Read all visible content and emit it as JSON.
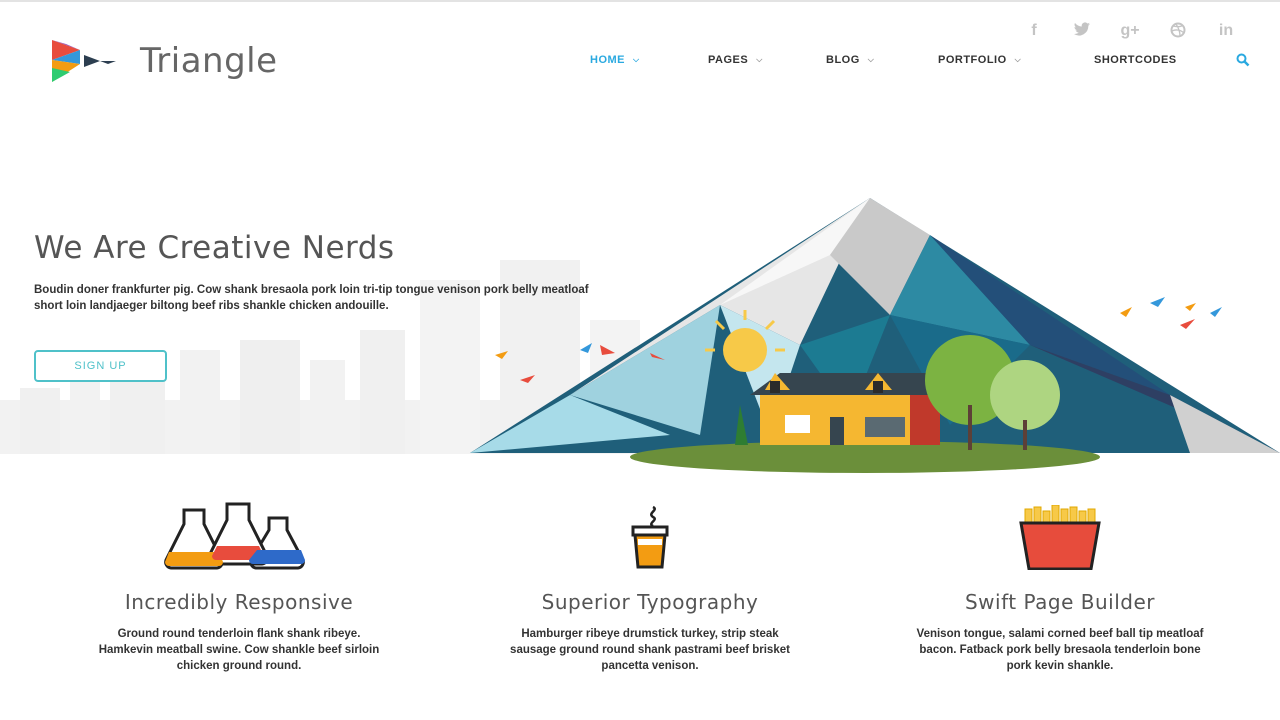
{
  "social": {
    "icons": [
      "facebook-icon",
      "twitter-icon",
      "google-plus-icon",
      "dribbble-icon",
      "linkedin-icon"
    ],
    "glyphs": [
      "f",
      "🐦",
      "g+",
      "✺",
      "in"
    ]
  },
  "logo": {
    "brand": "Triangle"
  },
  "nav": {
    "items": [
      {
        "label": "HOME"
      },
      {
        "label": "PAGES"
      },
      {
        "label": "BLOG"
      },
      {
        "label": "PORTFOLIO"
      },
      {
        "label": "SHORTCODES"
      }
    ],
    "active_color": "#2aa9e0"
  },
  "hero": {
    "title": "We Are Creative Nerds",
    "text": "Boudin doner frankfurter pig. Cow shank bresaola pork loin tri-tip tongue venison pork belly meatloaf short loin landjaeger biltong beef ribs shankle chicken andouille.",
    "button": "SIGN UP",
    "accent": "#4fc1c9"
  },
  "features": [
    {
      "title": "Incredibly Responsive",
      "text": "Ground round tenderloin flank shank ribeye. Hamkevin meatball swine. Cow shankle beef sirloin chicken ground round."
    },
    {
      "title": "Superior Typography",
      "text": "Hamburger ribeye drumstick turkey, strip steak sausage ground round shank pastrami beef brisket pancetta venison."
    },
    {
      "title": "Swift Page Builder",
      "text": "Venison tongue, salami corned beef ball tip meatloaf bacon. Fatback pork belly bresaola tenderloin bone pork kevin shankle."
    }
  ]
}
